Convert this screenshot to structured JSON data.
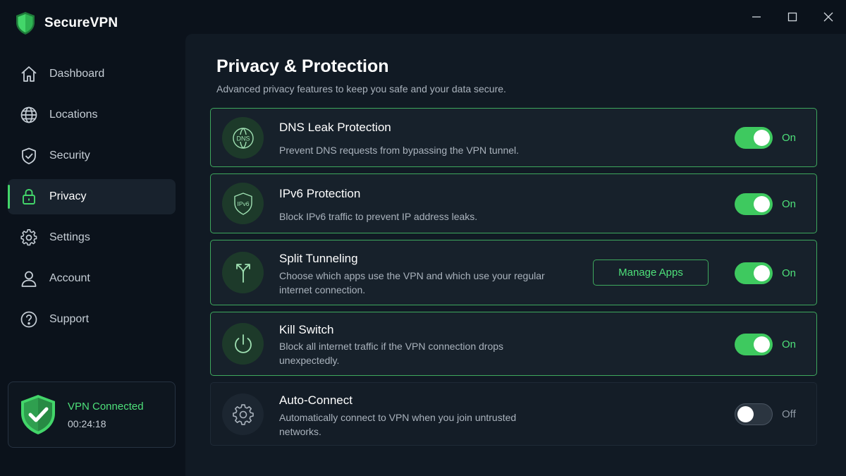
{
  "app": {
    "name": "SecureVPN"
  },
  "sidebar": {
    "items": [
      {
        "label": "Dashboard",
        "icon": "home-icon",
        "active": false
      },
      {
        "label": "Locations",
        "icon": "globe-icon",
        "active": false
      },
      {
        "label": "Security",
        "icon": "shield-check-icon",
        "active": false
      },
      {
        "label": "Privacy",
        "icon": "lock-icon",
        "active": true
      },
      {
        "label": "Settings",
        "icon": "gear-icon",
        "active": false
      },
      {
        "label": "Account",
        "icon": "user-icon",
        "active": false
      },
      {
        "label": "Support",
        "icon": "help-icon",
        "active": false
      }
    ]
  },
  "status": {
    "title": "VPN Connected",
    "time": "00:24:18"
  },
  "page": {
    "title": "Privacy & Protection",
    "subtitle": "Advanced privacy features to keep you safe and your data secure."
  },
  "features": [
    {
      "title": "DNS Leak Protection",
      "desc": "Prevent DNS requests from bypassing the VPN tunnel.",
      "state": "On",
      "enabled": true,
      "icon": "dns-globe-icon",
      "icon_text": "DNS"
    },
    {
      "title": "IPv6 Protection",
      "desc": "Block IPv6 traffic to prevent IP address leaks.",
      "state": "On",
      "enabled": true,
      "icon": "ipv6-shield-icon",
      "icon_text": "IPv6"
    },
    {
      "title": "Split Tunneling",
      "desc": "Choose which apps use the VPN and which use your regular internet connection.",
      "state": "On",
      "enabled": true,
      "icon": "split-arrow-icon",
      "button": "Manage Apps"
    },
    {
      "title": "Kill Switch",
      "desc": "Block all internet traffic if the VPN connection drops unexpectedly.",
      "state": "On",
      "enabled": true,
      "icon": "power-icon"
    },
    {
      "title": "Auto-Connect",
      "desc": "Automatically connect to VPN when you join untrusted networks.",
      "state": "Off",
      "enabled": false,
      "icon": "gear-icon"
    }
  ],
  "colors": {
    "accent": "#43d66a",
    "background": "#0b121b",
    "panel": "#111a24"
  }
}
